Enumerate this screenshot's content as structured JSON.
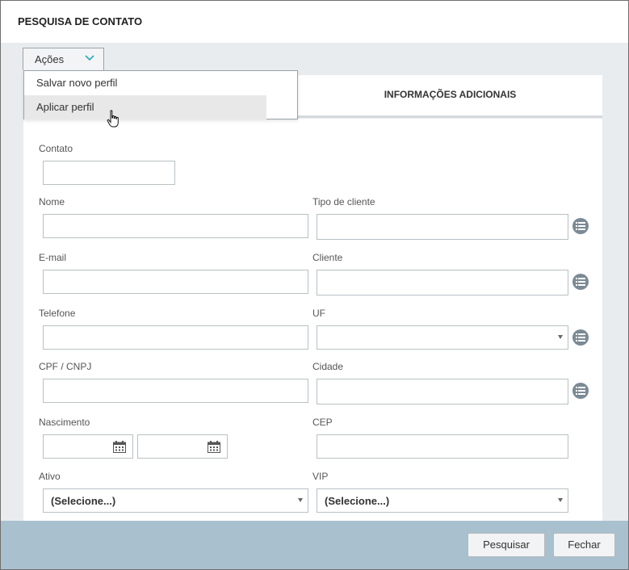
{
  "window": {
    "title": "PESQUISA DE CONTATO"
  },
  "acoes": {
    "label": "Ações",
    "menu": [
      "Salvar novo perfil",
      "Aplicar perfil"
    ]
  },
  "tabs": {
    "additional": "INFORMAÇÕES ADICIONAIS"
  },
  "form": {
    "contato": "Contato",
    "nome": "Nome",
    "tipo_cliente": "Tipo de cliente",
    "email": "E-mail",
    "cliente": "Cliente",
    "telefone": "Telefone",
    "uf": "UF",
    "cpf_cnpj": "CPF / CNPJ",
    "cidade": "Cidade",
    "nascimento": "Nascimento",
    "cep": "CEP",
    "ativo": "Ativo",
    "ativo_value": "(Selecione...)",
    "vip": "VIP",
    "vip_value": "(Selecione...)"
  },
  "footer": {
    "search": "Pesquisar",
    "close": "Fechar"
  },
  "colors": {
    "accent": "#2aa7c0",
    "footer": "#a9c0cf",
    "icon": "#7b8a94"
  },
  "icons": [
    "chevron-down-icon",
    "list-icon",
    "calendar-icon",
    "hand-cursor-icon"
  ]
}
